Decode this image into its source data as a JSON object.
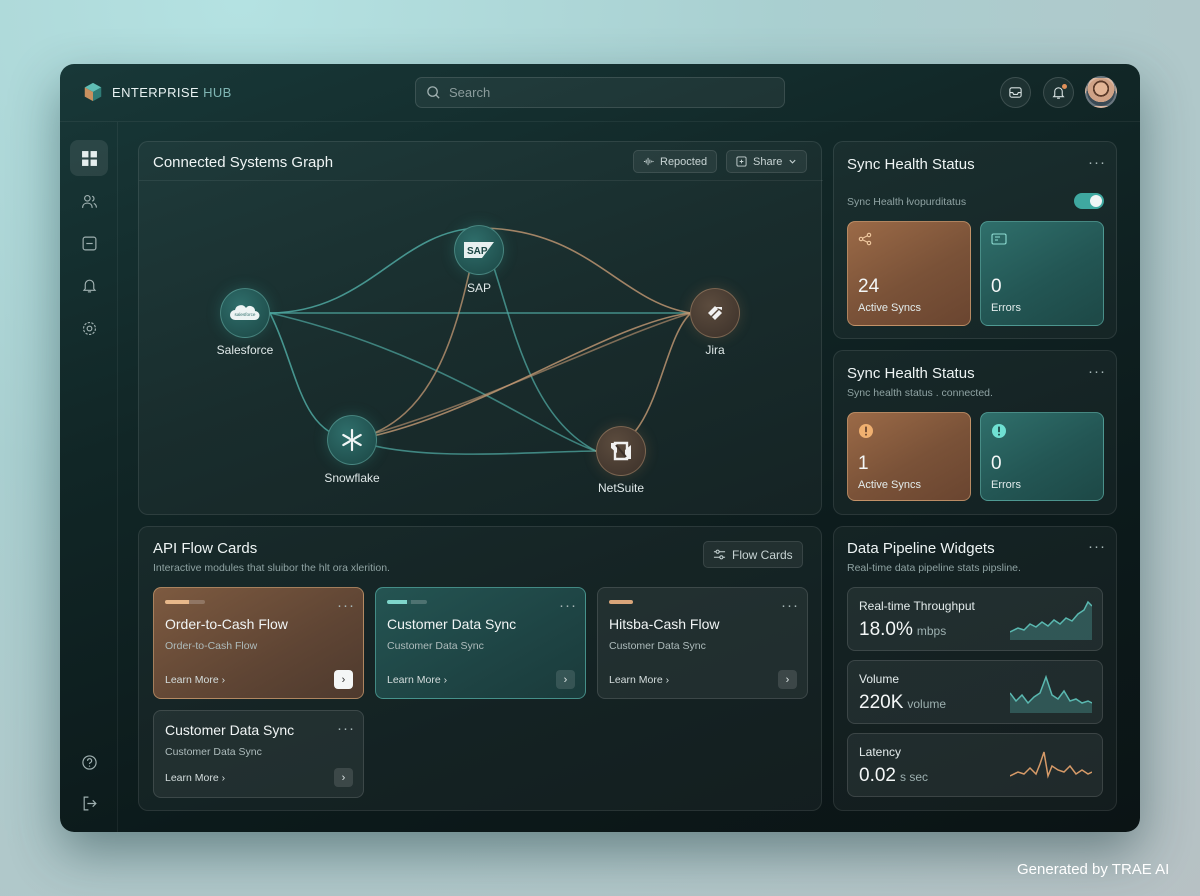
{
  "header": {
    "brand_primary": "ENTERPRISE",
    "brand_secondary": "HUB",
    "search_placeholder": "Search"
  },
  "sidebar": {
    "items": [
      {
        "icon": "dashboard-icon",
        "active": true
      },
      {
        "icon": "users-icon"
      },
      {
        "icon": "inbox-icon"
      },
      {
        "icon": "bell-icon"
      },
      {
        "icon": "settings-icon"
      }
    ],
    "bottom": [
      {
        "icon": "help-icon"
      },
      {
        "icon": "logout-icon"
      }
    ]
  },
  "graph": {
    "title": "Connected Systems Graph",
    "repocted_label": "Repocted",
    "share_label": "Share",
    "nodes": {
      "sap": "SAP",
      "salesforce": "Salesforce",
      "jira": "Jira",
      "snowflake": "Snowflake",
      "netsuite": "NetSuite"
    },
    "sap_logo_text": "SAP",
    "salesforce_logo_text": "salesforce"
  },
  "sync1": {
    "title": "Sync Health Status",
    "toggle_label": "Sync Health łvopurditatus",
    "toggle_on": true,
    "active_value": "24",
    "active_label": "Active Syncs",
    "errors_value": "0",
    "errors_label": "Errors"
  },
  "sync2": {
    "title": "Sync Health Status",
    "subtitle": "Sync health status . connected.",
    "active_value": "1",
    "active_label": "Active Syncs",
    "errors_value": "0",
    "errors_label": "Errors"
  },
  "flows": {
    "title": "API Flow Cards",
    "subtitle": "Interactive modules that sluibor the hlt ora xlerition.",
    "button_label": "Flow Cards",
    "cards": [
      {
        "title": "Order-to-Cash Flow",
        "subtitle": "Order-to-Cash Flow",
        "link": "Learn More"
      },
      {
        "title": "Customer Data Sync",
        "subtitle": "Customer Data Sync",
        "link": "Learn More"
      },
      {
        "title": "Hitsba-Cash Flow",
        "subtitle": "Customer Data Sync",
        "link": "Learn More"
      },
      {
        "title": "Customer Data Sync",
        "subtitle": "Customer Data Sync",
        "link": "Learn More"
      }
    ]
  },
  "pipeline": {
    "title": "Data Pipeline Widgets",
    "subtitle": "Real-time data pipeline stats pipsline.",
    "widgets": [
      {
        "label": "Real-time Throughput",
        "value": "18.0%",
        "unit": "mbps"
      },
      {
        "label": "Volume",
        "value": "220K",
        "unit": "volume"
      },
      {
        "label": "Latency",
        "value": "0.02",
        "unit": "s sec"
      }
    ]
  },
  "watermark": "Generated by TRAE AI",
  "colors": {
    "accent_teal": "#3fa8a0",
    "accent_orange": "#c98a5c",
    "background": "#112626"
  }
}
